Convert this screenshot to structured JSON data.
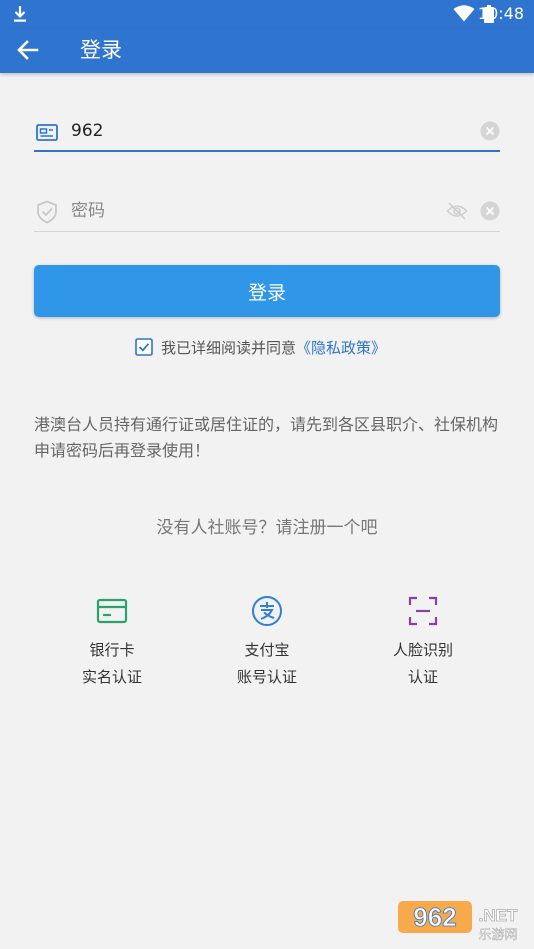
{
  "status_bar": {
    "time": "10:48"
  },
  "toolbar": {
    "title": "登录"
  },
  "account_field": {
    "value": "962"
  },
  "password_field": {
    "placeholder": "密码"
  },
  "login_button": {
    "label": "登录"
  },
  "agreement": {
    "checked": true,
    "text": "我已详细阅读并同意",
    "policy_link": "《隐私政策》"
  },
  "notice": "港澳台人员持有通行证或居住证的，请先到各区县职介、社保机构申请密码后再登录使用！",
  "register_prompt": "没有人社账号？请注册一个吧",
  "register_methods": [
    {
      "icon": "bank-card-icon",
      "line1": "银行卡",
      "line2": "实名认证",
      "color": "#2aa36b"
    },
    {
      "icon": "alipay-icon",
      "line1": "支付宝",
      "line2": "账号认证",
      "color": "#2f7fd6"
    },
    {
      "icon": "face-scan-icon",
      "line1": "人脸识别",
      "line2": "认证",
      "color": "#8a3ea8"
    }
  ],
  "watermark": {
    "brand": "962",
    "suffix": ".NET",
    "subtitle": "乐游网"
  },
  "colors": {
    "primary": "#2f74cf",
    "button": "#2f96e8",
    "background": "#f2f2f2"
  }
}
